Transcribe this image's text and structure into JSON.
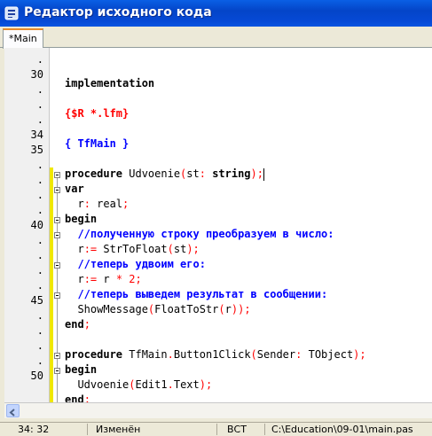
{
  "window": {
    "title": "Редактор исходного кода"
  },
  "tabs": [
    {
      "label": "*Main",
      "active": true
    }
  ],
  "colors": {
    "keyword": "#000000",
    "directive": "#ff0000",
    "comment": "#0000ff",
    "symbol": "#ff0000",
    "modified_bar": "#f0e800",
    "title_bar": "#0a54e0"
  },
  "gutter": {
    "line_labels": [
      ".",
      "30",
      ".",
      ".",
      ".",
      "34",
      "35",
      ".",
      ".",
      ".",
      ".",
      "40",
      ".",
      ".",
      ".",
      ".",
      "45",
      ".",
      ".",
      ".",
      ".",
      "50"
    ]
  },
  "code": {
    "lines": [
      [],
      [
        {
          "t": "implementation",
          "c": "kw"
        }
      ],
      [],
      [
        {
          "t": "{$R *.lfm}",
          "c": "dir"
        }
      ],
      [],
      [
        {
          "t": "{ TfMain }",
          "c": "com"
        }
      ],
      [],
      [
        {
          "t": "procedure ",
          "c": "kw"
        },
        {
          "t": "Udvoenie",
          "c": "id"
        },
        {
          "t": "(",
          "c": "sym"
        },
        {
          "t": "st",
          "c": "id"
        },
        {
          "t": ": ",
          "c": "sym"
        },
        {
          "t": "string",
          "c": "kw"
        },
        {
          "t": ");",
          "c": "sym"
        }
      ],
      [
        {
          "t": "var",
          "c": "kw"
        }
      ],
      [
        {
          "t": "  r",
          "c": "id"
        },
        {
          "t": ": ",
          "c": "sym"
        },
        {
          "t": "real",
          "c": "id"
        },
        {
          "t": ";",
          "c": "sym"
        }
      ],
      [
        {
          "t": "begin",
          "c": "kw"
        }
      ],
      [
        {
          "t": "  //полученную строку преобразуем в число:",
          "c": "com"
        }
      ],
      [
        {
          "t": "  r",
          "c": "id"
        },
        {
          "t": ":= ",
          "c": "sym"
        },
        {
          "t": "StrToFloat",
          "c": "id"
        },
        {
          "t": "(",
          "c": "sym"
        },
        {
          "t": "st",
          "c": "id"
        },
        {
          "t": ");",
          "c": "sym"
        }
      ],
      [
        {
          "t": "  //теперь удвоим его:",
          "c": "com"
        }
      ],
      [
        {
          "t": "  r",
          "c": "id"
        },
        {
          "t": ":= ",
          "c": "sym"
        },
        {
          "t": "r ",
          "c": "id"
        },
        {
          "t": "* 2;",
          "c": "sym"
        }
      ],
      [
        {
          "t": "  //теперь выведем результат в сообщении:",
          "c": "com"
        }
      ],
      [
        {
          "t": "  ShowMessage",
          "c": "id"
        },
        {
          "t": "(",
          "c": "sym"
        },
        {
          "t": "FloatToStr",
          "c": "id"
        },
        {
          "t": "(",
          "c": "sym"
        },
        {
          "t": "r",
          "c": "id"
        },
        {
          "t": "));",
          "c": "sym"
        }
      ],
      [
        {
          "t": "end",
          "c": "kw"
        },
        {
          "t": ";",
          "c": "sym"
        }
      ],
      [],
      [
        {
          "t": "procedure ",
          "c": "kw"
        },
        {
          "t": "TfMain",
          "c": "id"
        },
        {
          "t": ".",
          "c": "sym"
        },
        {
          "t": "Button1Click",
          "c": "id"
        },
        {
          "t": "(",
          "c": "sym"
        },
        {
          "t": "Sender",
          "c": "id"
        },
        {
          "t": ": ",
          "c": "sym"
        },
        {
          "t": "TObject",
          "c": "id"
        },
        {
          "t": ");",
          "c": "sym"
        }
      ],
      [
        {
          "t": "begin",
          "c": "kw"
        }
      ],
      [
        {
          "t": "  Udvoenie",
          "c": "id"
        },
        {
          "t": "(",
          "c": "sym"
        },
        {
          "t": "Edit1",
          "c": "id"
        },
        {
          "t": ".",
          "c": "sym"
        },
        {
          "t": "Text",
          "c": "id"
        },
        {
          "t": ");",
          "c": "sym"
        }
      ],
      [
        {
          "t": "end",
          "c": "kw"
        },
        {
          "t": ";",
          "c": "sym"
        }
      ]
    ]
  },
  "statusbar": {
    "position": "34: 32",
    "modified": "Изменён",
    "mode": "ВСТ",
    "path": "C:\\Education\\09-01\\main.pas"
  }
}
